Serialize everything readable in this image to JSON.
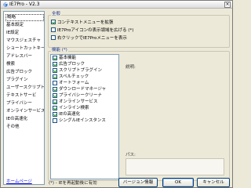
{
  "window": {
    "title": "IE7Pro - V2.3",
    "close_glyph": "×"
  },
  "sidebar": {
    "items": [
      {
        "label": "概略",
        "selected": true
      },
      {
        "label": "基本設定"
      },
      {
        "label": "IE設定"
      },
      {
        "label": "マウスジェスチャ"
      },
      {
        "label": "ショートカットキー"
      },
      {
        "label": "アドレスバー"
      },
      {
        "label": "検索"
      },
      {
        "label": "広告ブロック"
      },
      {
        "label": "プラグイン"
      },
      {
        "label": "ユーザースクリプト"
      },
      {
        "label": "テキストサービ"
      },
      {
        "label": "プライバシー"
      },
      {
        "label": "オンラインサービス"
      },
      {
        "label": "IEの高速化"
      },
      {
        "label": "その他"
      }
    ],
    "homepage_link": "ホームページ"
  },
  "general": {
    "heading": "全般",
    "options": [
      {
        "label": "コンテキストメニューを拡張",
        "checked": true
      },
      {
        "label": "IE7Proアイコンの表示領域を広げる (*)",
        "checked": false
      },
      {
        "label": "右クリックでIE7Proメニューを表示",
        "checked": false
      }
    ]
  },
  "modules": {
    "heading": "機能 (*)",
    "items": [
      {
        "label": "基本機能",
        "checked": true
      },
      {
        "label": "広告ブロック",
        "checked": true
      },
      {
        "label": "スクリプトプラグイン",
        "checked": true
      },
      {
        "label": "スペルチェック",
        "checked": true
      },
      {
        "label": "オートフォーム",
        "checked": false
      },
      {
        "label": "ダウンロードマネージャ",
        "checked": true
      },
      {
        "label": "プライバシークリーナ",
        "checked": true
      },
      {
        "label": "オンラインサービス",
        "checked": true
      },
      {
        "label": "インライン検索",
        "checked": true
      },
      {
        "label": "IEの高速化",
        "checked": true
      },
      {
        "label": "シングルIEインスタンス",
        "checked": false
      }
    ],
    "description_label": "説明:",
    "path_label": "パス:"
  },
  "footer": {
    "note": "(*) - IEを再起動後に有効",
    "version_button": "バージョン情報",
    "ok_button": "OK",
    "cancel_button": "キャンセル"
  },
  "colors": {
    "accent": "#1f3a93",
    "check": "#21a121",
    "link": "#0000ee"
  }
}
